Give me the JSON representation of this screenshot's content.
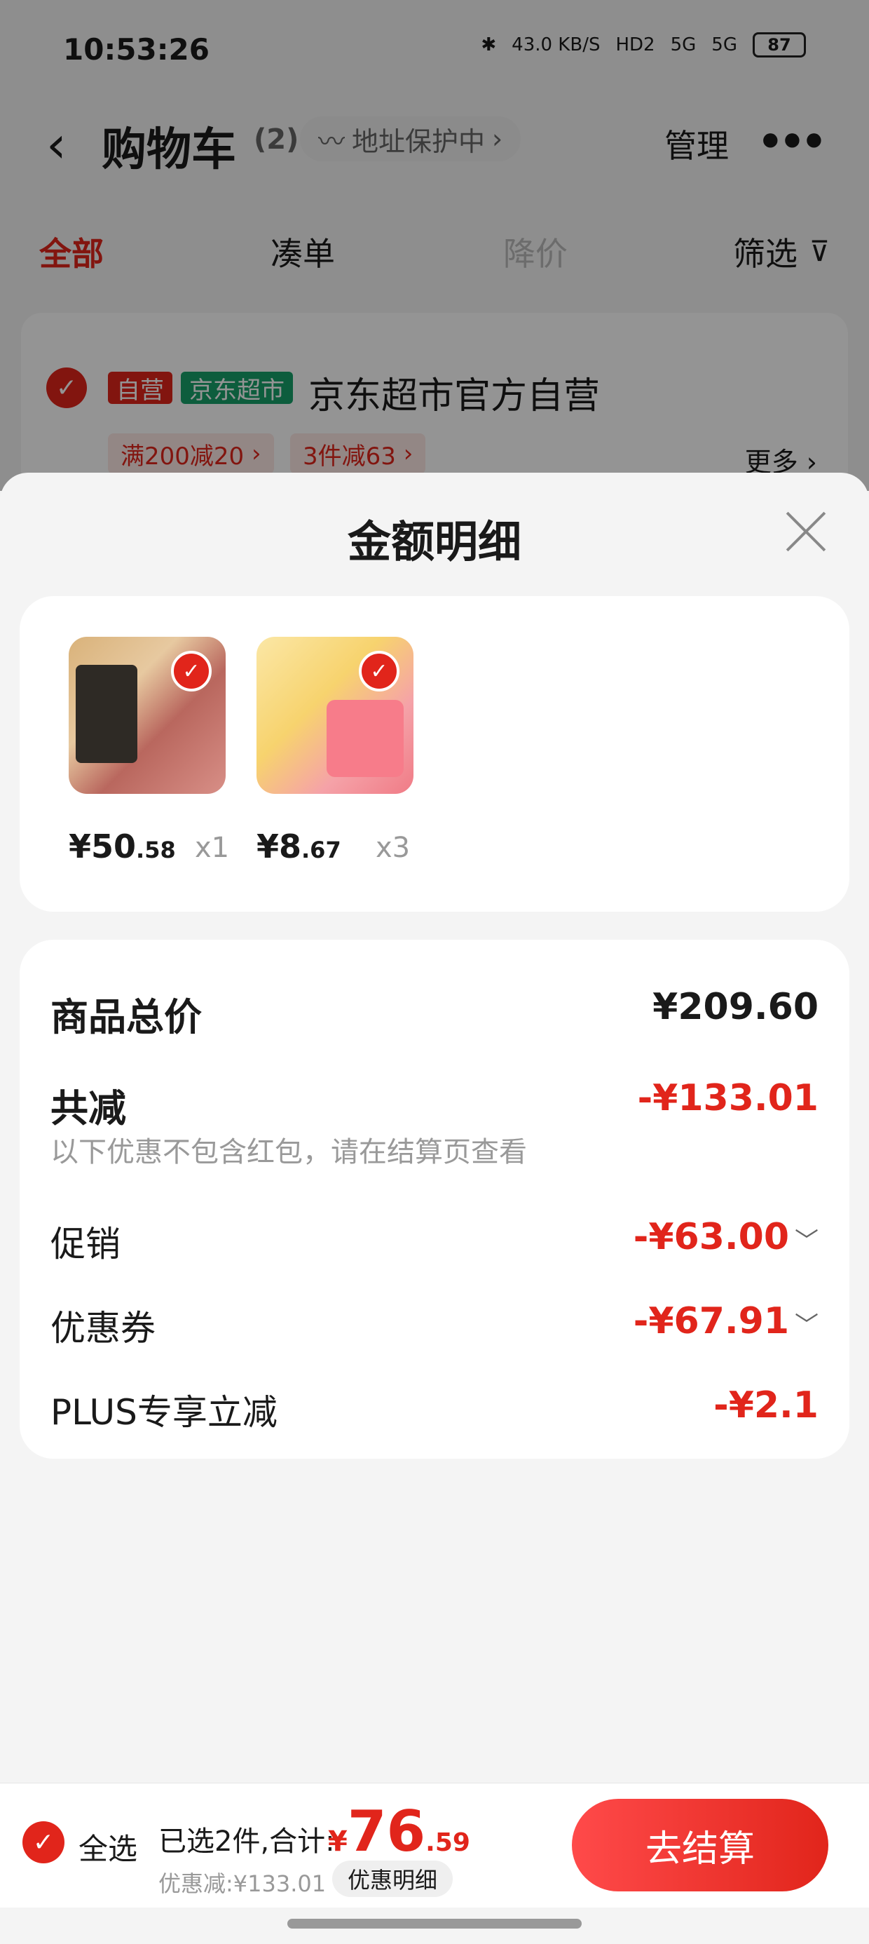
{
  "status_bar": {
    "time": "10:53:26",
    "net_speed": "43.0 KB/S",
    "hd_label": "HD2",
    "signal1": "5G",
    "signal2": "5G",
    "battery": "87"
  },
  "header": {
    "title": "购物车",
    "count": "(2)",
    "address_pill": "地址保护中",
    "manage": "管理",
    "more": "•••"
  },
  "tabs": [
    {
      "label": "全部",
      "state": "active"
    },
    {
      "label": "凑单",
      "state": "normal"
    },
    {
      "label": "降价",
      "state": "dim"
    },
    {
      "label": "筛选",
      "state": "normal"
    }
  ],
  "store": {
    "tag_self": "自营",
    "tag_market": "京东超市",
    "name": "京东超市官方自营",
    "promos": [
      "满200减20",
      "3件减63"
    ],
    "more": "更多"
  },
  "sheet": {
    "title": "金额明细",
    "products": [
      {
        "price_int": "¥50",
        "price_dec": ".58",
        "qty": "x1",
        "icon": "pork-product-image"
      },
      {
        "price_int": "¥8",
        "price_dec": ".67",
        "qty": "x3",
        "icon": "laundry-pod-product-image"
      }
    ],
    "summary": {
      "total_label": "商品总价",
      "total_value": "¥209.60",
      "reduce_label": "共减",
      "reduce_value": "-¥133.01",
      "note": "以下优惠不包含红包，请在结算页查看",
      "promo_label": "促销",
      "promo_value": "-¥63.00",
      "coupon_label": "优惠券",
      "coupon_value": "-¥67.91",
      "plus_label": "PLUS专享立减",
      "plus_value": "-¥2.1"
    }
  },
  "bottom_bar": {
    "select_all": "全选",
    "selected_text": "已选2件,合计:",
    "total_prefix": "¥",
    "total_int": "76",
    "total_dec": ".59",
    "discount_text": "优惠减:¥133.01",
    "detail_button": "优惠明细",
    "checkout": "去结算"
  },
  "colors": {
    "accent": "#e1251b",
    "market_green": "#17a06a"
  }
}
